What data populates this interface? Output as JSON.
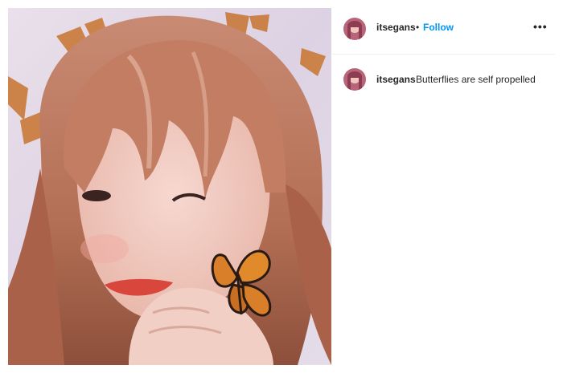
{
  "post": {
    "username": "itsegans",
    "separator": "•",
    "follow_label": "Follow",
    "more_label": "•••",
    "caption": {
      "username": "itsegans",
      "text": "Butterflies are self propelled"
    },
    "photo_subject": "portrait-with-butterfly",
    "colors": {
      "follow_blue": "#0095f6",
      "text": "#262626",
      "divider": "#efefef"
    }
  }
}
